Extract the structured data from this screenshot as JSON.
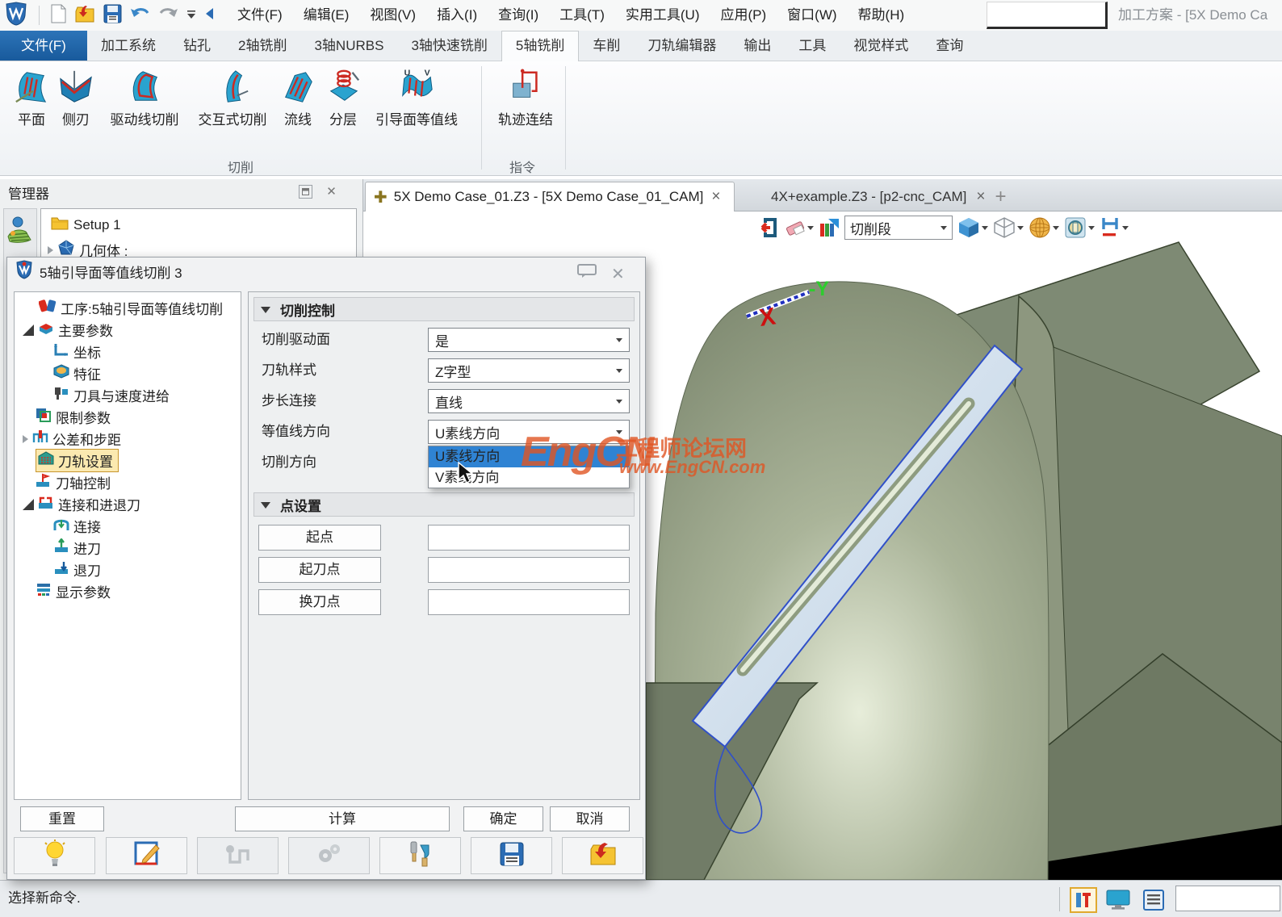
{
  "menubar": {
    "items": [
      "文件(F)",
      "编辑(E)",
      "视图(V)",
      "插入(I)",
      "查询(I)",
      "工具(T)",
      "实用工具(U)",
      "应用(P)",
      "窗口(W)",
      "帮助(H)"
    ],
    "window_title": "加工方案 - [5X Demo Ca"
  },
  "ribbon": {
    "file_tab": "文件(F)",
    "tabs": [
      "加工系统",
      "钻孔",
      "2轴铣削",
      "3轴NURBS",
      "3轴快速铣削",
      "5轴铣削",
      "车削",
      "刀轨编辑器",
      "输出",
      "工具",
      "视觉样式",
      "查询"
    ],
    "tools": [
      "平面",
      "侧刃",
      "驱动线切削",
      "交互式切削",
      "流线",
      "分层",
      "引导面等值线"
    ],
    "command_tool": "轨迹连结",
    "groups": {
      "cut": "切削",
      "command": "指令"
    }
  },
  "manager": {
    "title": "管理器",
    "setup": "Setup 1",
    "geometry": "几何体 :"
  },
  "documents": {
    "tab1": "5X Demo Case_01.Z3 - [5X Demo Case_01_CAM]",
    "tab2": "4X+example.Z3 - [p2-cnc_CAM]",
    "new_tab": "+"
  },
  "view_toolbar": {
    "display_mode": "切削段"
  },
  "dialog": {
    "title": "5轴引导面等值线切削 3",
    "tree": [
      "工序:5轴引导面等值线切削",
      "主要参数",
      "坐标",
      "特征",
      "刀具与速度进给",
      "限制参数",
      "公差和步距",
      "刀轨设置",
      "刀轴控制",
      "连接和进退刀",
      "连接",
      "进刀",
      "退刀",
      "显示参数"
    ],
    "cut_control": {
      "header": "切削控制",
      "rows": [
        {
          "label": "切削驱动面",
          "value": "是"
        },
        {
          "label": "刀轨样式",
          "value": "Z字型"
        },
        {
          "label": "步长连接",
          "value": "直线"
        },
        {
          "label": "等值线方向",
          "value": "U素线方向"
        },
        {
          "label": "切削方向",
          "value": ""
        }
      ]
    },
    "dropdown": {
      "options": [
        "U素线方向",
        "V素线方向"
      ]
    },
    "points": {
      "header": "点设置",
      "rows": [
        "起点",
        "起刀点",
        "换刀点"
      ]
    },
    "footer": {
      "reset": "重置",
      "calculate": "计算",
      "ok": "确定",
      "cancel": "取消"
    }
  },
  "viewport": {
    "axis": {
      "x": "X",
      "y": "-Y"
    }
  },
  "watermark": {
    "brand": "EngCN",
    "site": "工程师论坛网",
    "url": "www.EngCN.com"
  },
  "statusbar": {
    "message": "选择新命令."
  },
  "colors": {
    "accent_blue": "#185a9c",
    "selection_blue": "#2f83d3",
    "highlight_yellow": "#fbe9b0",
    "model_green": "#8a9480",
    "watermark_orange": "#e05523"
  }
}
